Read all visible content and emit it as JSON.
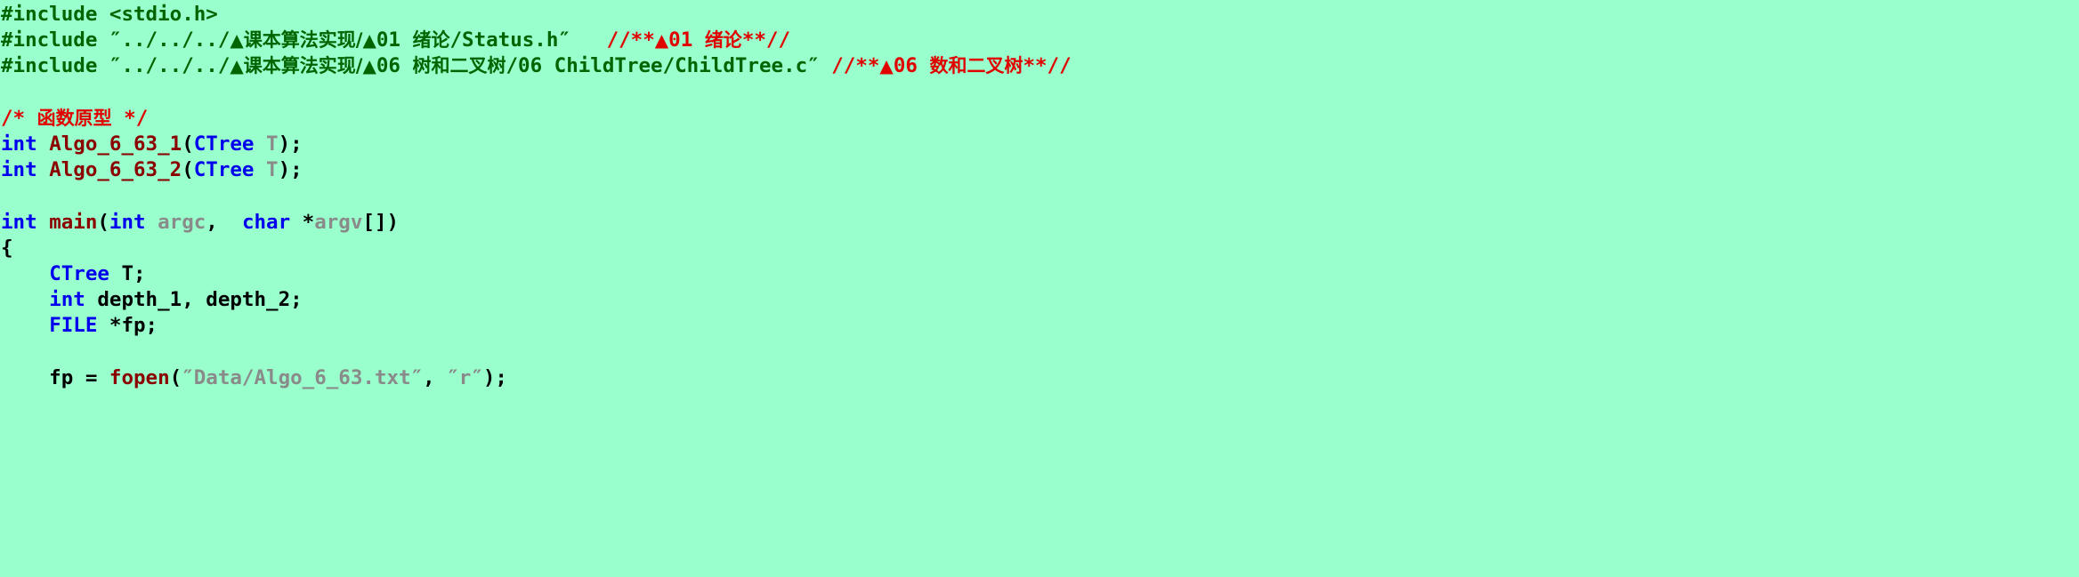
{
  "editor": {
    "background_color": "#99ffcc",
    "language": "C",
    "colors": {
      "preprocessor": "#006400",
      "string_green": "#006400",
      "comment_red": "#e00000",
      "keyword_blue": "#0000ee",
      "function_darkred": "#8b0000",
      "param_gray": "#8a8a8a",
      "plain_black": "#000000"
    }
  },
  "lines": [
    {
      "index": 1,
      "tokens": [
        {
          "text": "#include <stdio.h>",
          "kind": "preproc"
        }
      ]
    },
    {
      "index": 2,
      "tokens": [
        {
          "text": "#include ″../../../",
          "kind": "preproc"
        },
        {
          "text": "▲",
          "kind": "preproc-tri"
        },
        {
          "text": "课本算法实现/",
          "kind": "preproc-cjk"
        },
        {
          "text": "▲",
          "kind": "preproc-tri"
        },
        {
          "text": "01 ",
          "kind": "preproc"
        },
        {
          "text": "绪论",
          "kind": "preproc-cjk"
        },
        {
          "text": "/Status.h″",
          "kind": "preproc"
        },
        {
          "text": "   //**",
          "kind": "comment"
        },
        {
          "text": "▲",
          "kind": "comment-tri"
        },
        {
          "text": "01 ",
          "kind": "comment"
        },
        {
          "text": "绪论",
          "kind": "comment-cjk"
        },
        {
          "text": "**//",
          "kind": "comment"
        }
      ]
    },
    {
      "index": 3,
      "tokens": [
        {
          "text": "#include ″../../../",
          "kind": "preproc"
        },
        {
          "text": "▲",
          "kind": "preproc-tri"
        },
        {
          "text": "课本算法实现/",
          "kind": "preproc-cjk"
        },
        {
          "text": "▲",
          "kind": "preproc-tri"
        },
        {
          "text": "06 ",
          "kind": "preproc"
        },
        {
          "text": "树和二叉树",
          "kind": "preproc-cjk"
        },
        {
          "text": "/06 ChildTree/ChildTree.c″",
          "kind": "preproc"
        },
        {
          "text": " //**",
          "kind": "comment"
        },
        {
          "text": "▲",
          "kind": "comment-tri"
        },
        {
          "text": "06 ",
          "kind": "comment"
        },
        {
          "text": "数和二叉树",
          "kind": "comment-cjk"
        },
        {
          "text": "**//",
          "kind": "comment"
        }
      ]
    },
    {
      "index": 4,
      "tokens": []
    },
    {
      "index": 5,
      "tokens": [
        {
          "text": "/* ",
          "kind": "comment"
        },
        {
          "text": "函数原型",
          "kind": "comment-cjk"
        },
        {
          "text": " */",
          "kind": "comment"
        }
      ]
    },
    {
      "index": 6,
      "tokens": [
        {
          "text": "int",
          "kind": "keyword"
        },
        {
          "text": " ",
          "kind": "plain"
        },
        {
          "text": "Algo_6_63_1",
          "kind": "func"
        },
        {
          "text": "(",
          "kind": "plain"
        },
        {
          "text": "CTree",
          "kind": "type"
        },
        {
          "text": " ",
          "kind": "plain"
        },
        {
          "text": "T",
          "kind": "param"
        },
        {
          "text": ");",
          "kind": "plain"
        }
      ]
    },
    {
      "index": 7,
      "tokens": [
        {
          "text": "int",
          "kind": "keyword"
        },
        {
          "text": " ",
          "kind": "plain"
        },
        {
          "text": "Algo_6_63_2",
          "kind": "func"
        },
        {
          "text": "(",
          "kind": "plain"
        },
        {
          "text": "CTree",
          "kind": "type"
        },
        {
          "text": " ",
          "kind": "plain"
        },
        {
          "text": "T",
          "kind": "param"
        },
        {
          "text": ");",
          "kind": "plain"
        }
      ]
    },
    {
      "index": 8,
      "tokens": []
    },
    {
      "index": 9,
      "tokens": [
        {
          "text": "int",
          "kind": "keyword"
        },
        {
          "text": " ",
          "kind": "plain"
        },
        {
          "text": "main",
          "kind": "func"
        },
        {
          "text": "(",
          "kind": "plain"
        },
        {
          "text": "int",
          "kind": "keyword"
        },
        {
          "text": " ",
          "kind": "plain"
        },
        {
          "text": "argc",
          "kind": "param"
        },
        {
          "text": ",  ",
          "kind": "plain"
        },
        {
          "text": "char",
          "kind": "keyword"
        },
        {
          "text": " *",
          "kind": "plain"
        },
        {
          "text": "argv",
          "kind": "param"
        },
        {
          "text": "[])",
          "kind": "plain"
        }
      ]
    },
    {
      "index": 10,
      "tokens": [
        {
          "text": "{",
          "kind": "plain"
        }
      ]
    },
    {
      "index": 11,
      "tokens": [
        {
          "text": "    ",
          "kind": "plain"
        },
        {
          "text": "CTree",
          "kind": "type"
        },
        {
          "text": " T;",
          "kind": "plain"
        }
      ]
    },
    {
      "index": 12,
      "tokens": [
        {
          "text": "    ",
          "kind": "plain"
        },
        {
          "text": "int",
          "kind": "keyword"
        },
        {
          "text": " depth_1, depth_2;",
          "kind": "plain"
        }
      ]
    },
    {
      "index": 13,
      "tokens": [
        {
          "text": "    ",
          "kind": "plain"
        },
        {
          "text": "FILE",
          "kind": "type"
        },
        {
          "text": " *fp;",
          "kind": "plain"
        }
      ]
    },
    {
      "index": 14,
      "tokens": []
    },
    {
      "index": 15,
      "tokens": [
        {
          "text": "    fp = ",
          "kind": "plain"
        },
        {
          "text": "fopen",
          "kind": "func"
        },
        {
          "text": "(",
          "kind": "plain"
        },
        {
          "text": "″Data/Algo_6_63.txt″",
          "kind": "str-gray"
        },
        {
          "text": ", ",
          "kind": "plain"
        },
        {
          "text": "″r″",
          "kind": "str-gray"
        },
        {
          "text": ");",
          "kind": "plain"
        }
      ]
    }
  ]
}
